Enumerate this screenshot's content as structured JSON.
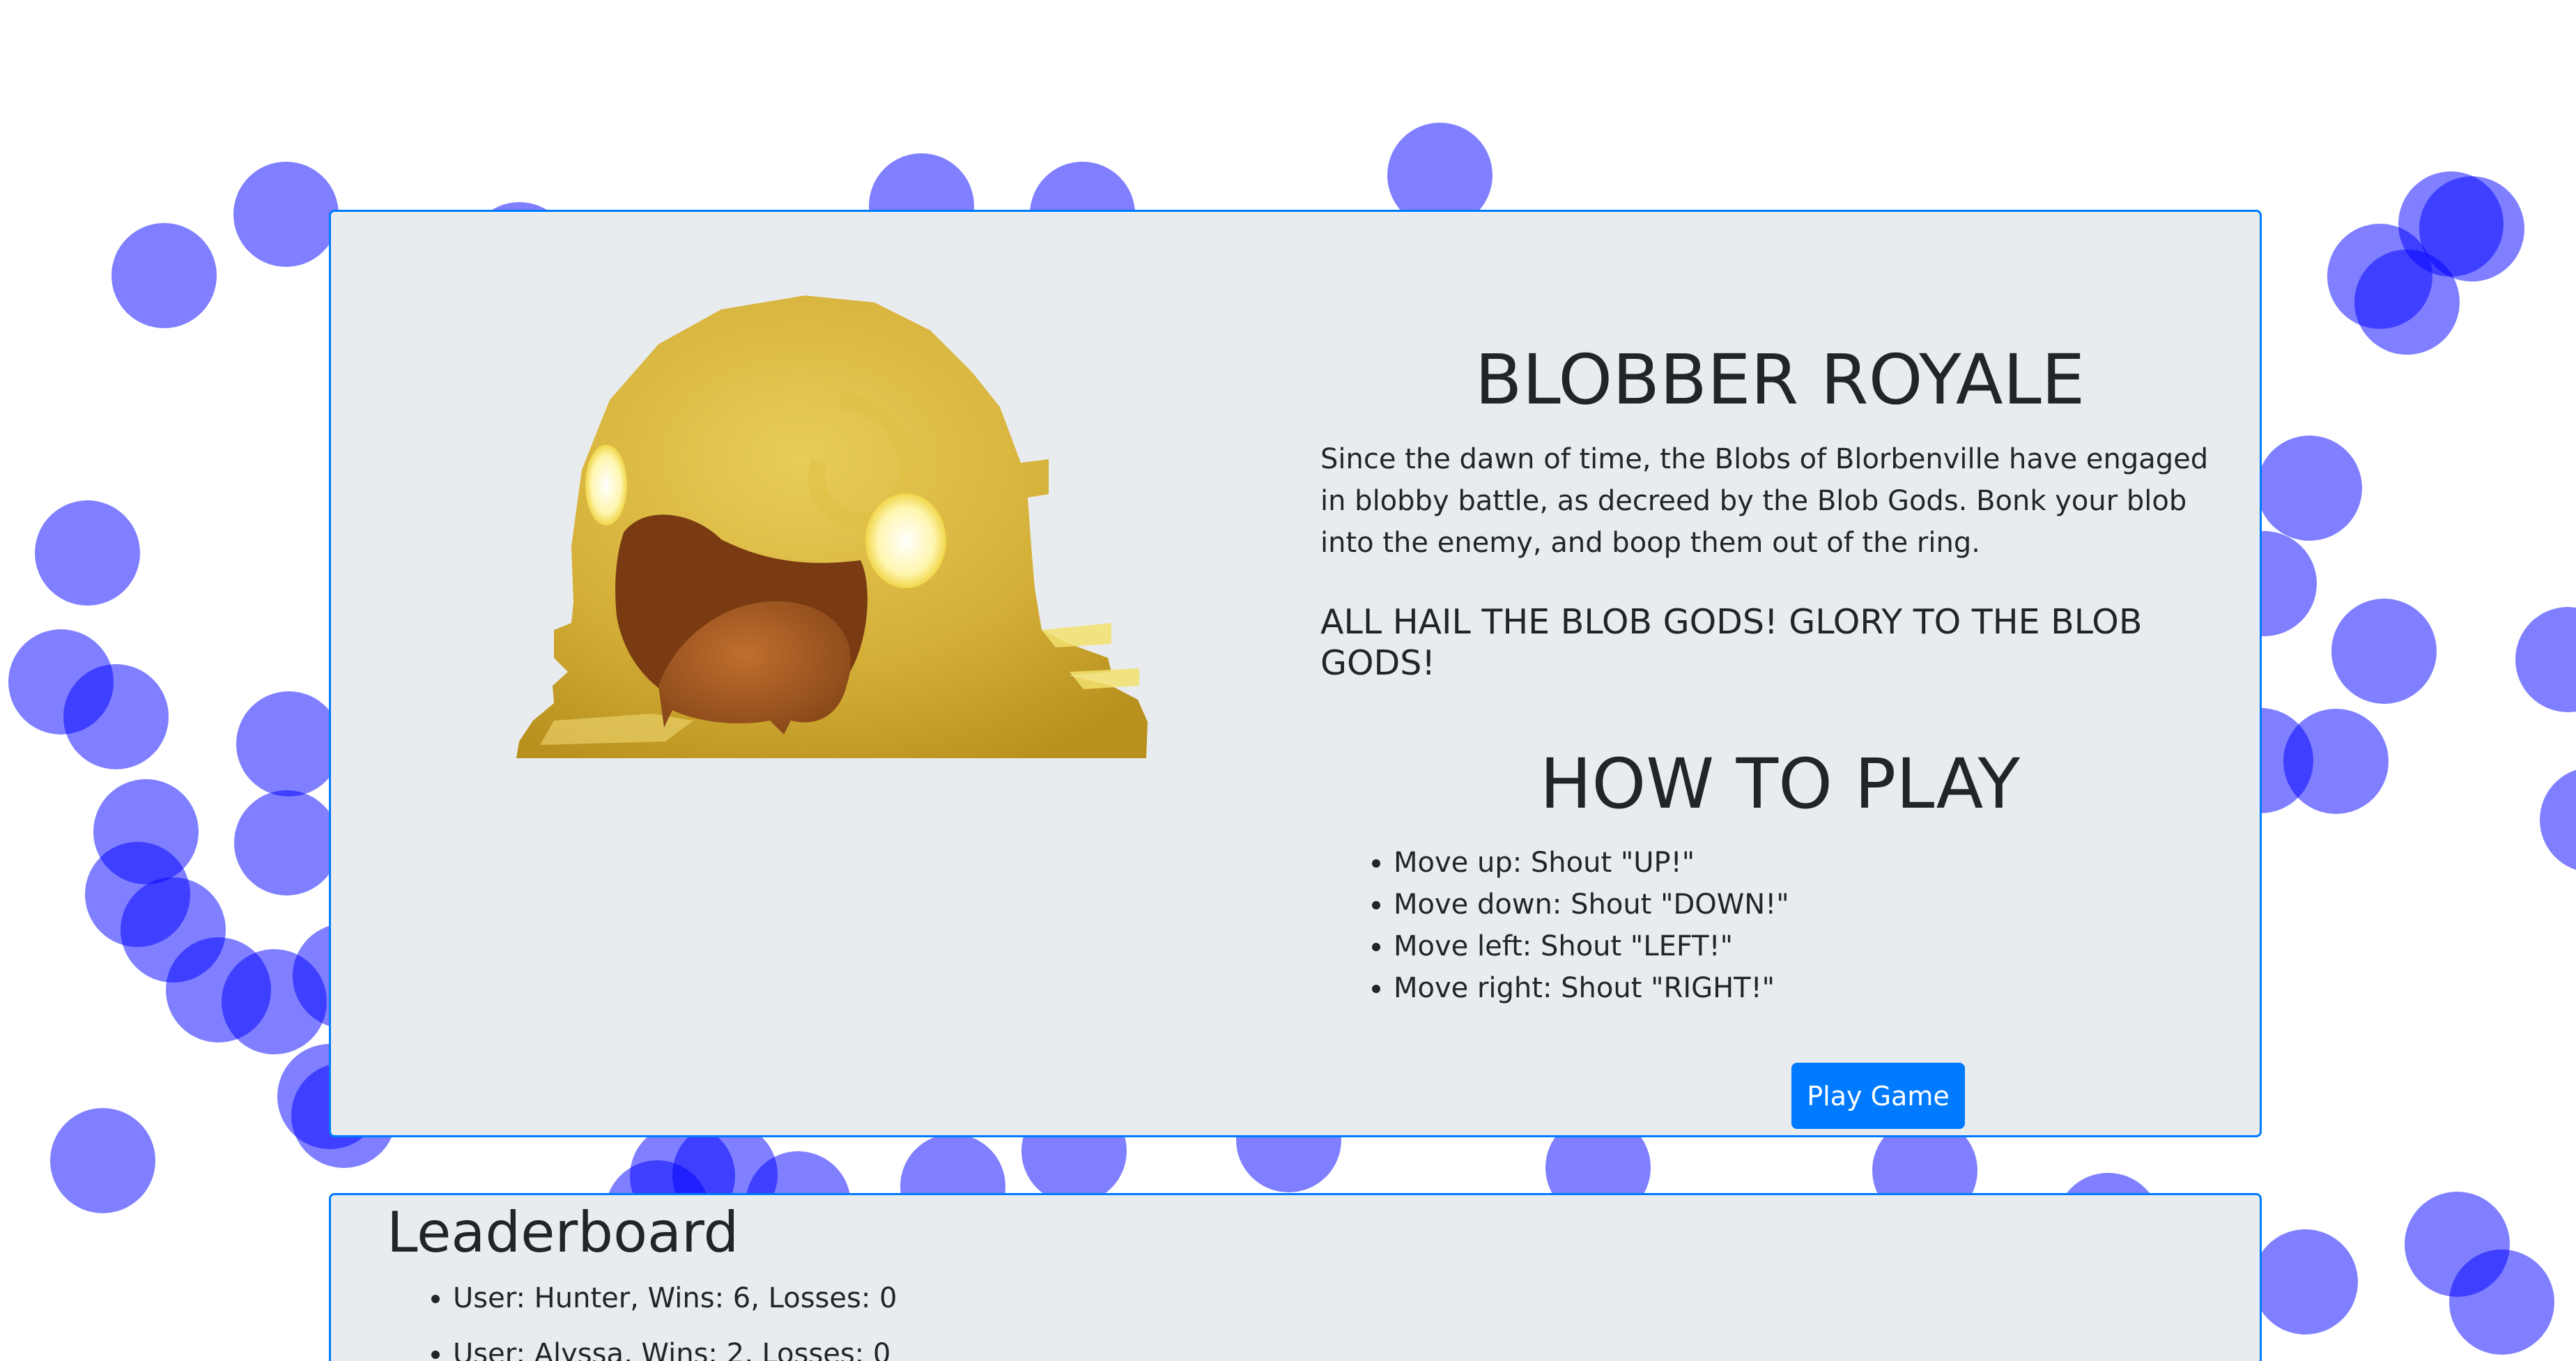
{
  "colors": {
    "bubble": "#0000ff",
    "panel_background": "#e9ecef",
    "panel_border": "#007bff",
    "button_primary": "#007bff",
    "text": "#212529",
    "blob_body": "#d9b63a",
    "blob_mouth": "#8a4a1c"
  },
  "hero": {
    "image_description": "blob-monster-icon",
    "title": "BLOBBER ROYALE",
    "intro": "Since the dawn of time, the Blobs of Blorbenville have engaged in blobby battle, as decreed by the Blob Gods. Bonk your blob into the enemy, and boop them out of the ring.",
    "hail": "ALL HAIL THE BLOB GODS! GLORY TO THE BLOB GODS!"
  },
  "how_to_play": {
    "title": "HOW TO PLAY",
    "controls": [
      "Move up: Shout \"UP!\"",
      "Move down: Shout \"DOWN!\"",
      "Move left: Shout \"LEFT!\"",
      "Move right: Shout \"RIGHT!\""
    ]
  },
  "actions": {
    "play_label": "Play Game"
  },
  "leaderboard": {
    "title": "Leaderboard",
    "entries": [
      "User: Hunter, Wins: 6, Losses: 0",
      "User: Alyssa, Wins: 2, Losses: 0"
    ]
  }
}
